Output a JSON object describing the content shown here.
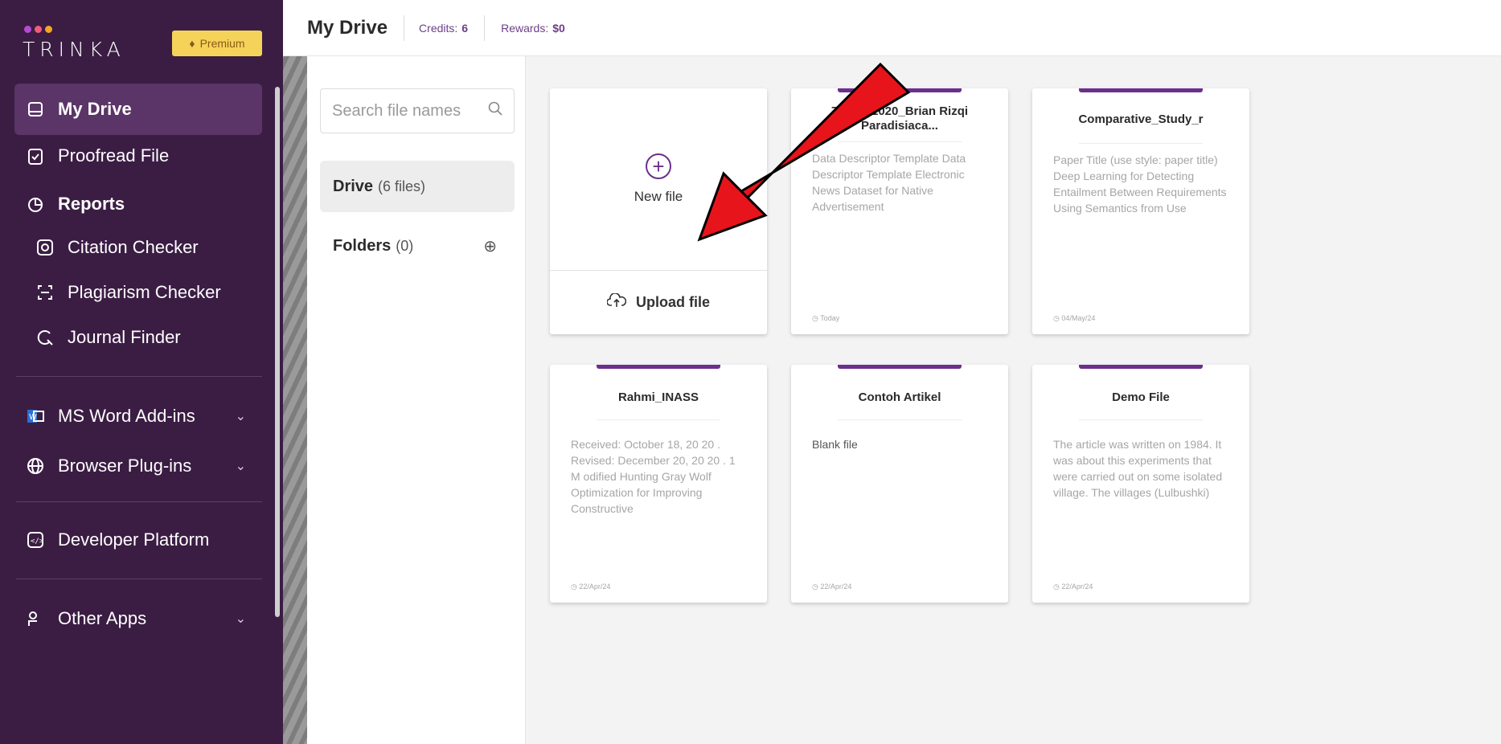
{
  "brand": {
    "name": "TRINKA",
    "dot_colors": [
      "#b44bd6",
      "#f25c7a",
      "#f5a623"
    ],
    "premium_label": "Premium"
  },
  "sidebar": {
    "items": [
      {
        "label": "My Drive",
        "icon": "drive-icon"
      },
      {
        "label": "Proofread File",
        "icon": "clipboard-check-icon"
      },
      {
        "label": "Reports",
        "icon": "reports-icon"
      },
      {
        "label": "Citation Checker",
        "icon": "citation-icon"
      },
      {
        "label": "Plagiarism Checker",
        "icon": "plagiarism-icon"
      },
      {
        "label": "Journal Finder",
        "icon": "journal-search-icon"
      },
      {
        "label": "MS Word Add-ins",
        "icon": "word-icon"
      },
      {
        "label": "Browser Plug-ins",
        "icon": "globe-icon"
      },
      {
        "label": "Developer Platform",
        "icon": "code-icon"
      },
      {
        "label": "Other Apps",
        "icon": "apps-icon"
      }
    ]
  },
  "header": {
    "title": "My Drive",
    "credits_label": "Credits:",
    "credits_value": "6",
    "rewards_label": "Rewards:",
    "rewards_value": "$0"
  },
  "drive_panel": {
    "search_placeholder": "Search file names",
    "drive_label": "Drive",
    "drive_count": "(6 files)",
    "folders_label": "Folders",
    "folders_count": "(0)"
  },
  "new_card": {
    "new_label": "New file",
    "upload_label": "Upload file"
  },
  "files": [
    {
      "title": "7025221020_Brian Rizqi Paradisiaca...",
      "body": "Data Descriptor Template Data Descriptor Template Electronic News Dataset for Native Advertisement",
      "date": "Today"
    },
    {
      "title": "Comparative_Study_r",
      "body": "Paper Title (use style: paper title) Deep Learning for Detecting Entailment Between Requirements Using Semantics from Use",
      "date": "04/May/24"
    },
    {
      "title": "Rahmi_INASS",
      "body": "Received: October 18, 20 20 . Revised: December 20, 20 20 . 1 M odified Hunting Gray Wolf Optimization for Improving Constructive",
      "date": "22/Apr/24"
    },
    {
      "title": "Contoh Artikel",
      "body": "Blank file",
      "date": "22/Apr/24"
    },
    {
      "title": "Demo File",
      "body": "The article was written on 1984. It was about this experiments that were carried out on some isolated village. The villages (Lulbushki)",
      "date": "22/Apr/24"
    }
  ],
  "colors": {
    "sidebar_bg": "#3b1d44",
    "accent": "#6b2f8c",
    "annotation_arrow": "#e8141b"
  }
}
